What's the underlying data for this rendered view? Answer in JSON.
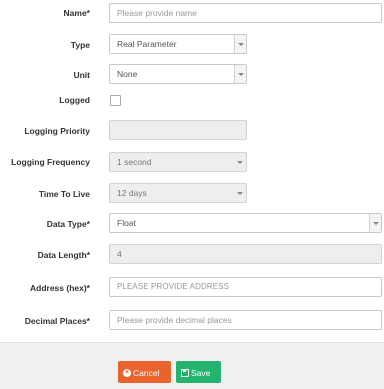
{
  "form": {
    "name": {
      "label": "Name*",
      "placeholder": "Please provide name"
    },
    "type": {
      "label": "Type",
      "value": "Real Parameter"
    },
    "unit": {
      "label": "Unit",
      "value": "None"
    },
    "logged": {
      "label": "Logged",
      "checked": false
    },
    "logging_priority": {
      "label": "Logging Priority",
      "value": ""
    },
    "logging_frequency": {
      "label": "Logging Frequency",
      "value": "1 second"
    },
    "time_to_live": {
      "label": "Time To Live",
      "value": "12 days"
    },
    "data_type": {
      "label": "Data Type*",
      "value": "Float"
    },
    "data_length": {
      "label": "Data Length*",
      "value": "4"
    },
    "address": {
      "label": "Address (hex)*",
      "placeholder": "PLEASE PROVIDE ADDRESS"
    },
    "decimal_places": {
      "label": "Decimal Places*",
      "placeholder": "Please provide decimal places"
    }
  },
  "footer": {
    "cancel_label": "Cancel",
    "save_label": "Save"
  },
  "colors": {
    "cancel": "#e9632c",
    "save": "#24b26f",
    "footer_bg": "#f0f0f0",
    "disabled_bg": "#eeeeee"
  },
  "icons": {
    "cancel": "times-circle-icon",
    "save": "floppy-disk-icon"
  }
}
